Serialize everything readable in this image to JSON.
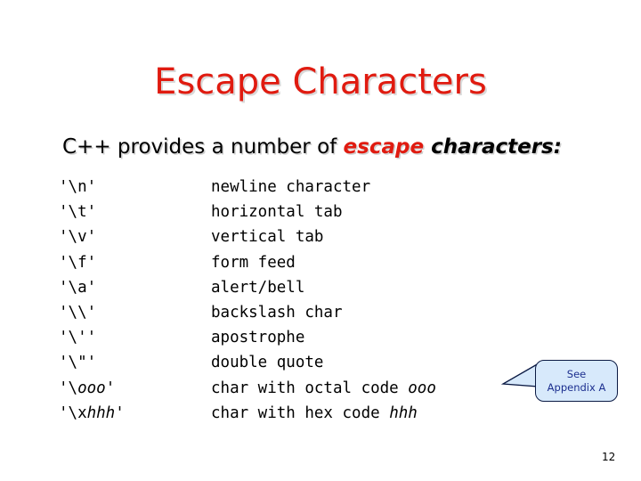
{
  "slide": {
    "title": "Escape Characters",
    "subtitle": {
      "lead": "C++ provides a number of ",
      "emphasis_red": "escape",
      "emphasis_black": " characters:"
    },
    "page_number": "12",
    "colors": {
      "title_red": "#e01b10",
      "title_shadow": "#d9d9d9",
      "body_text": "#000000",
      "callout_fill": "#d7e9fb",
      "callout_border": "#0b1a44",
      "callout_text": "#1c2f8f",
      "background": "#ffffff"
    }
  },
  "escape_table": {
    "rows": [
      {
        "code": "'\\n'",
        "desc": "newline character",
        "desc_italic": ""
      },
      {
        "code": "'\\t'",
        "desc": "horizontal tab",
        "desc_italic": ""
      },
      {
        "code": "'\\v'",
        "desc": "vertical tab",
        "desc_italic": ""
      },
      {
        "code": "'\\f'",
        "desc": "form feed",
        "desc_italic": ""
      },
      {
        "code": "'\\a'",
        "desc": "alert/bell",
        "desc_italic": ""
      },
      {
        "code": "'\\\\'",
        "desc": "backslash char",
        "desc_italic": ""
      },
      {
        "code": "'\\''",
        "desc": "apostrophe",
        "desc_italic": ""
      },
      {
        "code": "'\\\"'",
        "desc": "double quote",
        "desc_italic": ""
      },
      {
        "code": "'\\",
        "code_italic": "ooo",
        "code_tail": "'",
        "desc": "char with octal code ",
        "desc_italic": "ooo"
      },
      {
        "code": "'\\x",
        "code_italic": "hhh",
        "code_tail": "'",
        "desc": "char with hex code ",
        "desc_italic": "hhh"
      }
    ]
  },
  "callout": {
    "line1": "See",
    "line2": "Appendix A"
  }
}
